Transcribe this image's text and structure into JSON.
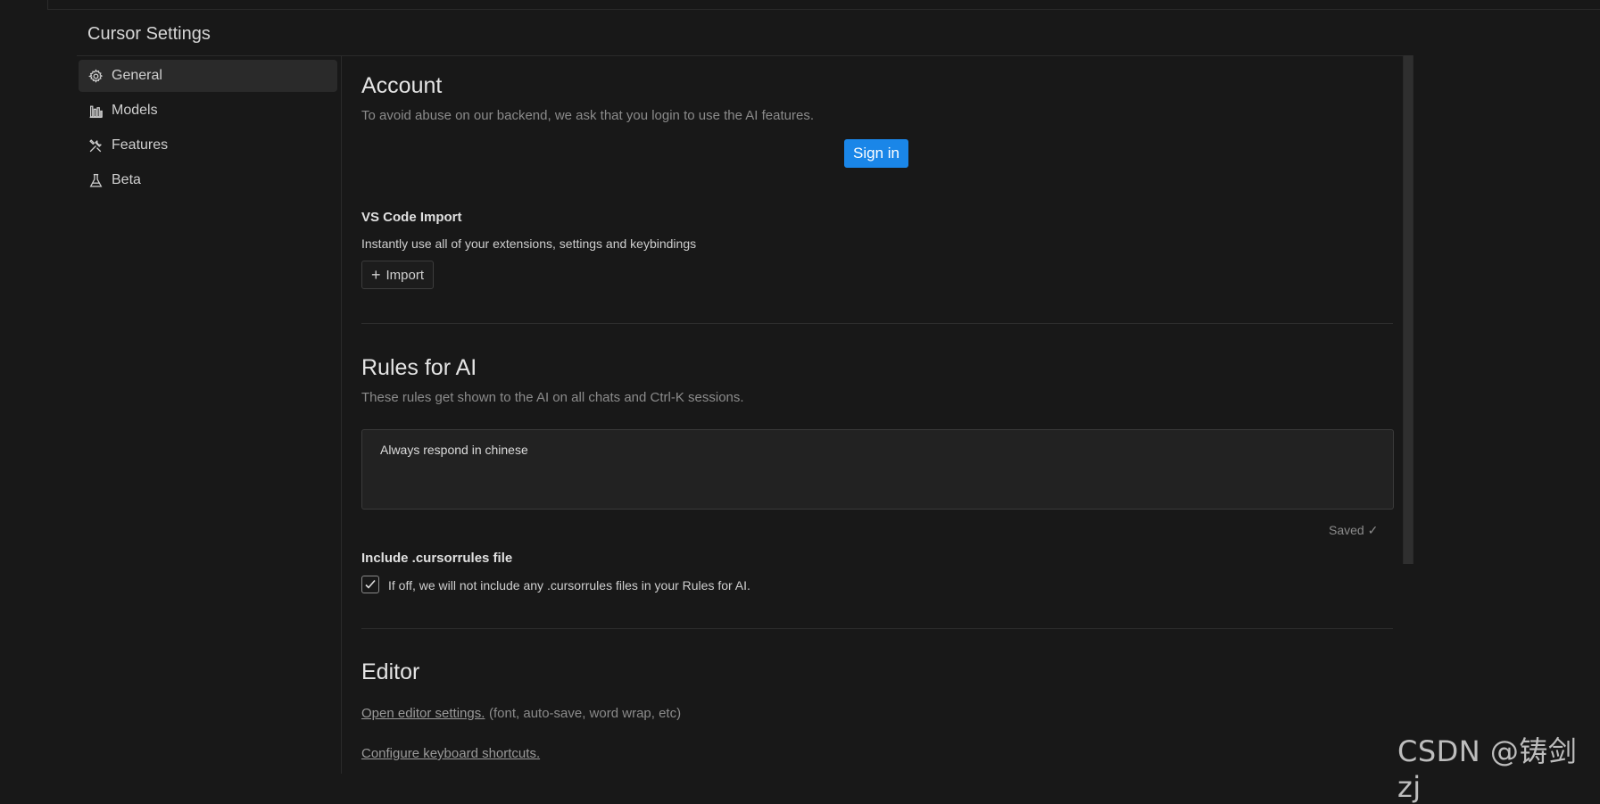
{
  "window": {
    "title": "Cursor Settings"
  },
  "sidebar": {
    "items": [
      {
        "label": "General",
        "icon": "gear-icon",
        "active": true
      },
      {
        "label": "Models",
        "icon": "bar-chart-icon",
        "active": false
      },
      {
        "label": "Features",
        "icon": "tools-icon",
        "active": false
      },
      {
        "label": "Beta",
        "icon": "flask-icon",
        "active": false
      }
    ]
  },
  "account": {
    "title": "Account",
    "subtitle": "To avoid abuse on our backend, we ask that you login to use the AI features.",
    "sign_in_label": "Sign in"
  },
  "vscode_import": {
    "title": "VS Code Import",
    "description": "Instantly use all of your extensions, settings and keybindings",
    "button_label": "Import"
  },
  "rules": {
    "title": "Rules for AI",
    "subtitle": "These rules get shown to the AI on all chats and Ctrl-K sessions.",
    "value": "Always respond in chinese",
    "saved_label": "Saved ✓"
  },
  "cursorrules": {
    "title": "Include .cursorrules file",
    "checked": true,
    "description": "If off, we will not include any .cursorrules files in your Rules for AI."
  },
  "editor": {
    "title": "Editor",
    "open_settings_link": "Open editor settings.",
    "open_settings_hint": "(font, auto-save, word wrap, etc)",
    "keyboard_link": "Configure keyboard shortcuts."
  },
  "watermark": "CSDN @铸剑zj",
  "colors": {
    "background": "#181818",
    "accent": "#1a86e8",
    "sidebar_active": "#2a2a2a"
  }
}
